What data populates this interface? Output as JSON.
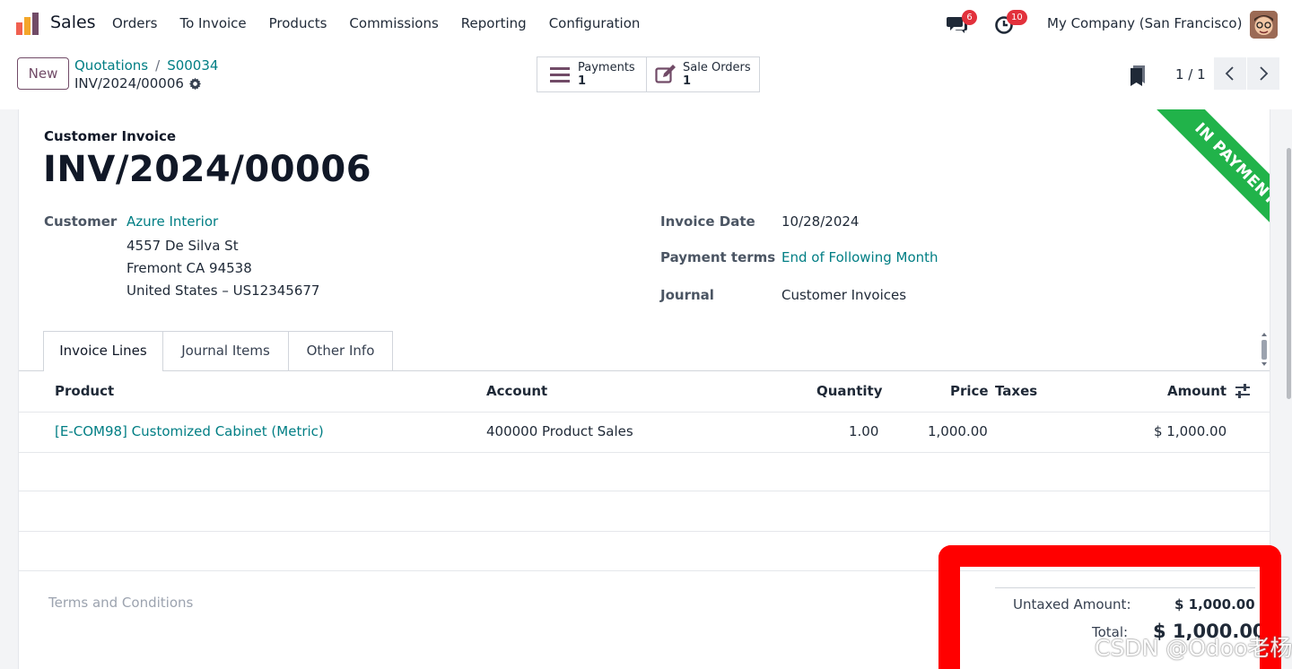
{
  "nav": {
    "app_name": "Sales",
    "menu": [
      "Orders",
      "To Invoice",
      "Products",
      "Commissions",
      "Reporting",
      "Configuration"
    ],
    "messages_count": "6",
    "activities_count": "10",
    "company": "My Company (San Francisco)"
  },
  "control": {
    "new_label": "New",
    "breadcrumb": [
      "Quotations",
      "S00034"
    ],
    "current_record": "INV/2024/00006",
    "smart_buttons": [
      {
        "label": "Payments",
        "count": "1",
        "icon": "list-icon"
      },
      {
        "label": "Sale Orders",
        "count": "1",
        "icon": "edit-icon"
      }
    ],
    "pager": "1 / 1"
  },
  "invoice": {
    "doc_type": "Customer Invoice",
    "number": "INV/2024/00006",
    "ribbon": "IN PAYMENT",
    "ribbon_color": "#21b34a",
    "customer_label": "Customer",
    "customer_name": "Azure Interior",
    "address": [
      "4557 De Silva St",
      "Fremont CA 94538",
      "United States – US12345677"
    ],
    "invoice_date_label": "Invoice Date",
    "invoice_date": "10/28/2024",
    "payment_terms_label": "Payment terms",
    "payment_terms": "End of Following Month",
    "journal_label": "Journal",
    "journal": "Customer Invoices"
  },
  "tabs": [
    "Invoice Lines",
    "Journal Items",
    "Other Info"
  ],
  "lines": {
    "headers": {
      "product": "Product",
      "account": "Account",
      "quantity": "Quantity",
      "price": "Price",
      "taxes": "Taxes",
      "amount": "Amount"
    },
    "rows": [
      {
        "product": "[E-COM98] Customized Cabinet (Metric)",
        "account": "400000 Product Sales",
        "quantity": "1.00",
        "price": "1,000.00",
        "taxes": "",
        "amount": "$ 1,000.00"
      }
    ]
  },
  "footer": {
    "terms_placeholder": "Terms and Conditions",
    "untaxed_label": "Untaxed Amount:",
    "untaxed_value": "$ 1,000.00",
    "total_label": "Total:",
    "total_value": "$ 1,000.00"
  },
  "colors": {
    "brand": "#714b67",
    "link": "#017e84",
    "badge": "#e2313c",
    "annotation": "#ff0000"
  },
  "watermark": "CSDN @Odoo老杨"
}
